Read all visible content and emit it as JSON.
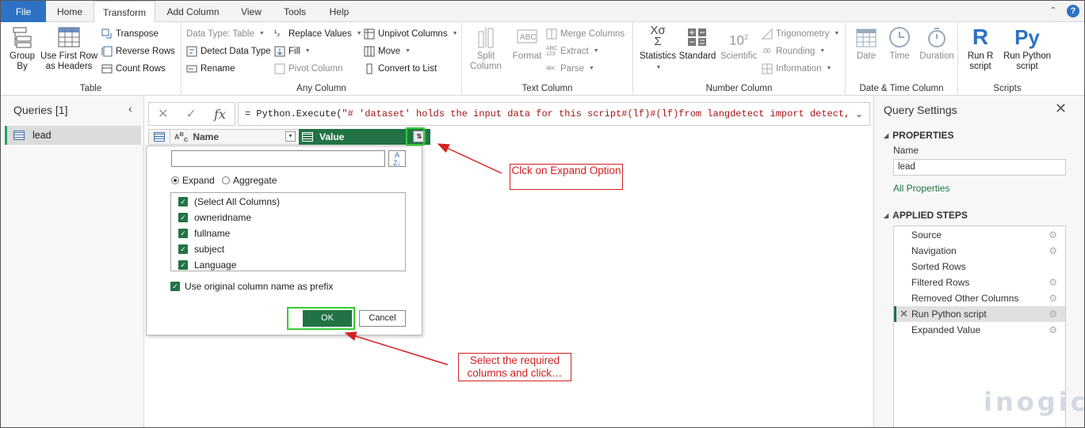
{
  "menu": {
    "tabs": [
      "File",
      "Home",
      "Transform",
      "Add Column",
      "View",
      "Tools",
      "Help"
    ],
    "active": "Transform"
  },
  "ribbon": {
    "table": {
      "label": "Table",
      "group_by": "Group\nBy",
      "first_row": "Use First Row\nas Headers",
      "transpose": "Transpose",
      "reverse_rows": "Reverse Rows",
      "count_rows": "Count Rows"
    },
    "any_column": {
      "label": "Any Column",
      "data_type": "Data Type: Table",
      "detect_type": "Detect Data Type",
      "rename": "Rename",
      "replace_values": "Replace Values",
      "fill": "Fill",
      "pivot_column": "Pivot Column",
      "unpivot": "Unpivot Columns",
      "move": "Move",
      "convert_list": "Convert to List"
    },
    "text_column": {
      "label": "Text Column",
      "split": "Split\nColumn",
      "format": "Format",
      "merge": "Merge Columns",
      "extract": "Extract",
      "parse": "Parse"
    },
    "number_column": {
      "label": "Number Column",
      "statistics": "Statistics",
      "standard": "Standard",
      "scientific": "Scientific",
      "trig": "Trigonometry",
      "rounding": "Rounding",
      "information": "Information"
    },
    "datetime_column": {
      "label": "Date & Time Column",
      "date": "Date",
      "time": "Time",
      "duration": "Duration"
    },
    "scripts": {
      "label": "Scripts",
      "run_r": "Run R\nscript",
      "run_py": "Run Python\nscript"
    }
  },
  "queries": {
    "title": "Queries [1]",
    "items": [
      "lead"
    ]
  },
  "formula": {
    "prefix": "= Python.Execute(",
    "text": "\"# 'dataset' holds the input data for this script#(lf)#(lf)from langdetect import detect,"
  },
  "grid": {
    "col1": "Name",
    "col2": "Value"
  },
  "expand_popup": {
    "expand_label": "Expand",
    "aggregate_label": "Aggregate",
    "columns": [
      "(Select All Columns)",
      "owneridname",
      "fullname",
      "subject",
      "Language"
    ],
    "prefix_label": "Use original column name as prefix",
    "ok": "OK",
    "cancel": "Cancel"
  },
  "callouts": {
    "expand": "Clck on Expand Option",
    "select": "Select the required columns  and click…"
  },
  "query_settings": {
    "title": "Query Settings",
    "properties": "PROPERTIES",
    "name_label": "Name",
    "name_value": "lead",
    "all_props": "All Properties",
    "applied_steps": "APPLIED STEPS",
    "steps": [
      "Source",
      "Navigation",
      "Sorted Rows",
      "Filtered Rows",
      "Removed Other Columns",
      "Run Python script",
      "Expanded Value"
    ]
  },
  "brand": "inogic",
  "colors": {
    "accent_green": "#217346",
    "file_blue": "#2d72c4",
    "annotation_red": "#d42020",
    "highlight_green": "#33cc33"
  }
}
